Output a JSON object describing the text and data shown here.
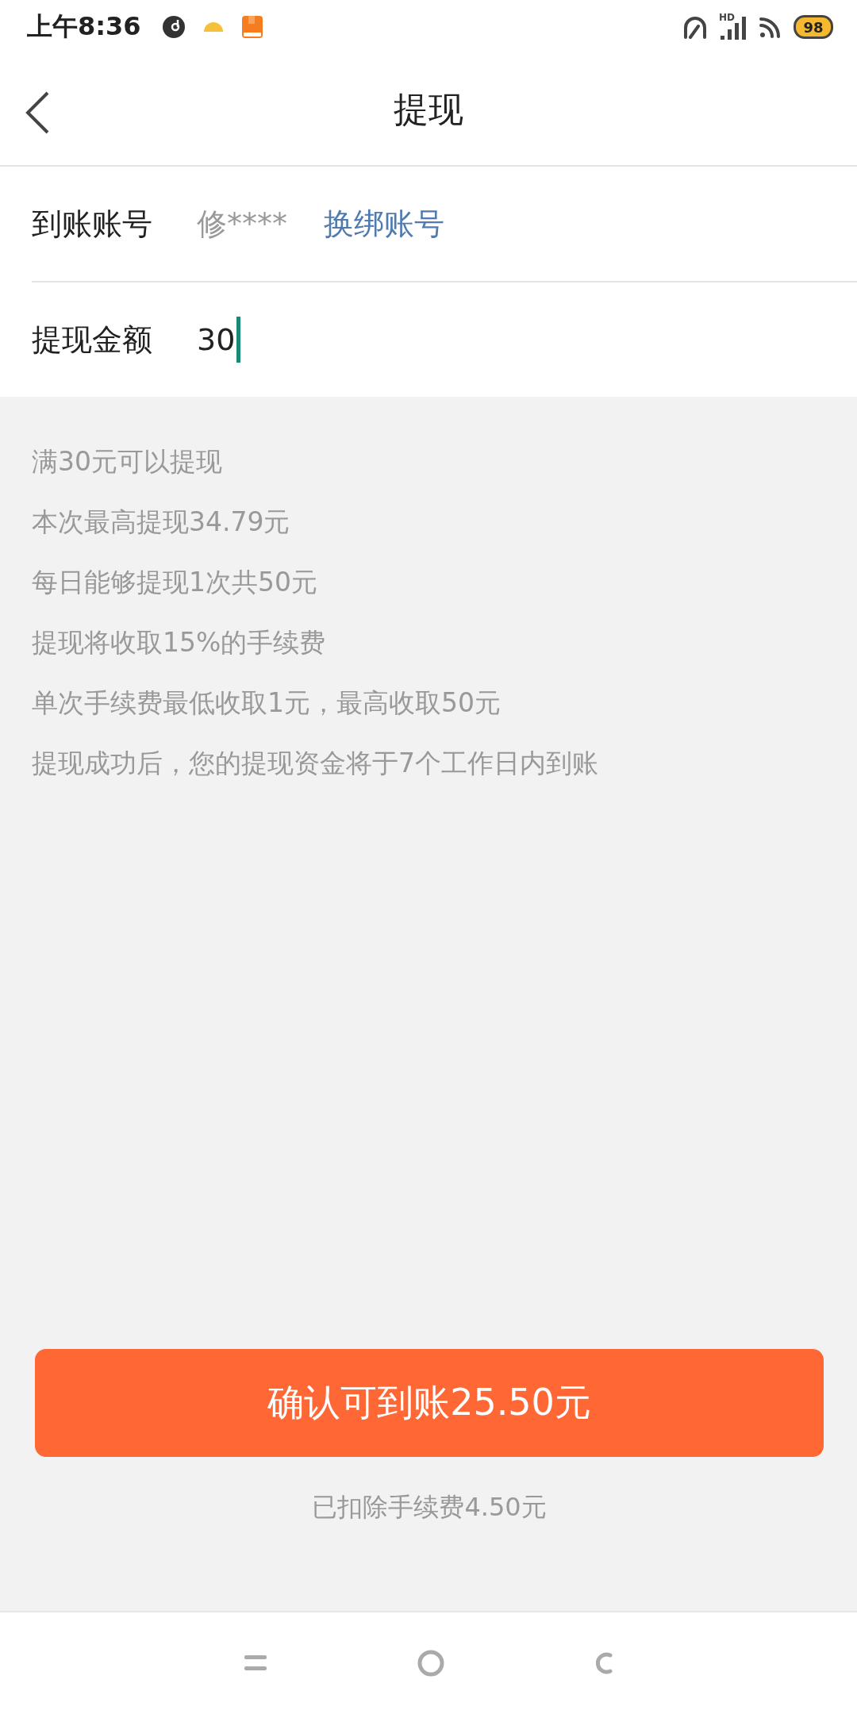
{
  "status_bar": {
    "time": "上午8:36",
    "network_label": "HD",
    "battery": "98"
  },
  "header": {
    "title": "提现"
  },
  "account": {
    "label": "到账账号",
    "value": "修****",
    "link": "换绑账号"
  },
  "amount": {
    "label": "提现金额",
    "value": "30",
    "focused": true
  },
  "notes": [
    "满30元可以提现",
    "本次最高提现34.79元",
    "每日能够提现1次共50元",
    "提现将收取15%的手续费",
    "单次手续费最低收取1元，最高收取50元",
    "提现成功后，您的提现资金将于7个工作日内到账"
  ],
  "confirm_button": "确认可到账25.50元",
  "fee_note": "已扣除手续费4.50元"
}
